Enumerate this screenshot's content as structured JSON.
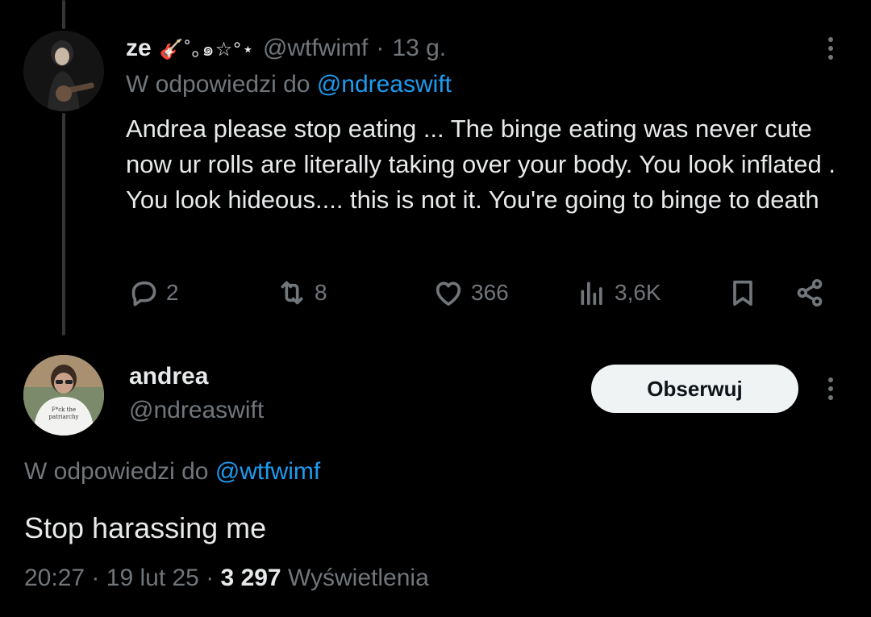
{
  "tweet1": {
    "author_name": "ze",
    "author_decoration": "🎸˚｡๑☆°⋆",
    "handle": "@wtfwimf",
    "separator": "·",
    "age": "13 g.",
    "reply_prefix": "W odpowiedzi do",
    "reply_to": "@ndreaswift",
    "text": "Andrea please stop eating ... The binge eating was never cute now ur rolls are literally taking over your body. You look inflated . You look hideous.... this is not it. You're going to binge to death",
    "actions": {
      "replies": "2",
      "retweets": "8",
      "likes": "366",
      "views": "3,6K"
    },
    "icons": [
      "reply-icon",
      "retweet-icon",
      "heart-icon",
      "views-icon",
      "bookmark-icon",
      "share-icon",
      "more-icon"
    ]
  },
  "tweet2": {
    "author_name": "andrea",
    "handle": "@ndreaswift",
    "follow_label": "Obserwuj",
    "reply_prefix": "W odpowiedzi do",
    "reply_to": "@wtfwimf",
    "text": "Stop harassing me",
    "time": "20:27",
    "date": "19 lut 25",
    "separator": "·",
    "views_count": "3 297",
    "views_label": "Wyświetlenia"
  },
  "colors": {
    "background": "#000000",
    "text": "#e7e9ea",
    "muted": "#71767b",
    "link": "#1d9bf0",
    "follow_button_bg": "#eff3f4",
    "follow_button_text": "#0f1419"
  }
}
